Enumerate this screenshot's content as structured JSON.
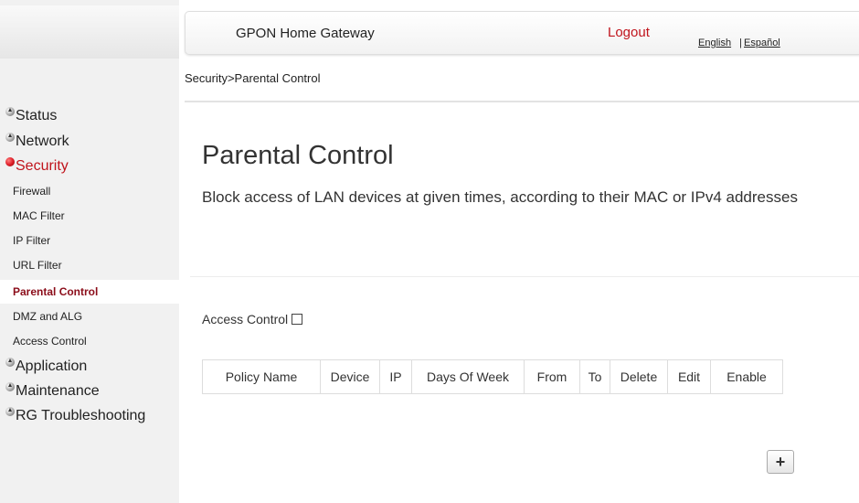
{
  "header": {
    "title": "GPON Home Gateway",
    "logout": "Logout",
    "lang_english": "English",
    "lang_separator": "|",
    "lang_spanish": "Español"
  },
  "breadcrumb": "Security>Parental Control",
  "sidebar": {
    "top_items": [
      {
        "label": "Status"
      },
      {
        "label": "Network"
      },
      {
        "label": "Security",
        "active": true
      },
      {
        "label": "Application"
      },
      {
        "label": "Maintenance"
      },
      {
        "label": "RG Troubleshooting"
      }
    ],
    "sub_items": [
      {
        "label": "Firewall"
      },
      {
        "label": "MAC Filter"
      },
      {
        "label": "IP Filter"
      },
      {
        "label": "URL Filter"
      },
      {
        "label": "Parental Control",
        "active": true
      },
      {
        "label": "DMZ and ALG"
      },
      {
        "label": "Access Control"
      }
    ]
  },
  "main": {
    "title": "Parental Control",
    "description": "Block access of LAN devices at given times, according to their MAC or IPv4 addresses",
    "access_control_label": "Access Control",
    "access_control_checked": false,
    "table_headers": [
      "Policy Name",
      "Device",
      "IP",
      "Days Of Week",
      "From",
      "To",
      "Delete",
      "Edit",
      "Enable"
    ],
    "add_button": "+"
  },
  "colors": {
    "accent_red": "#c0141c",
    "active_sub": "#8b0d1a",
    "sidebar_bg": "#f1f1f1"
  }
}
